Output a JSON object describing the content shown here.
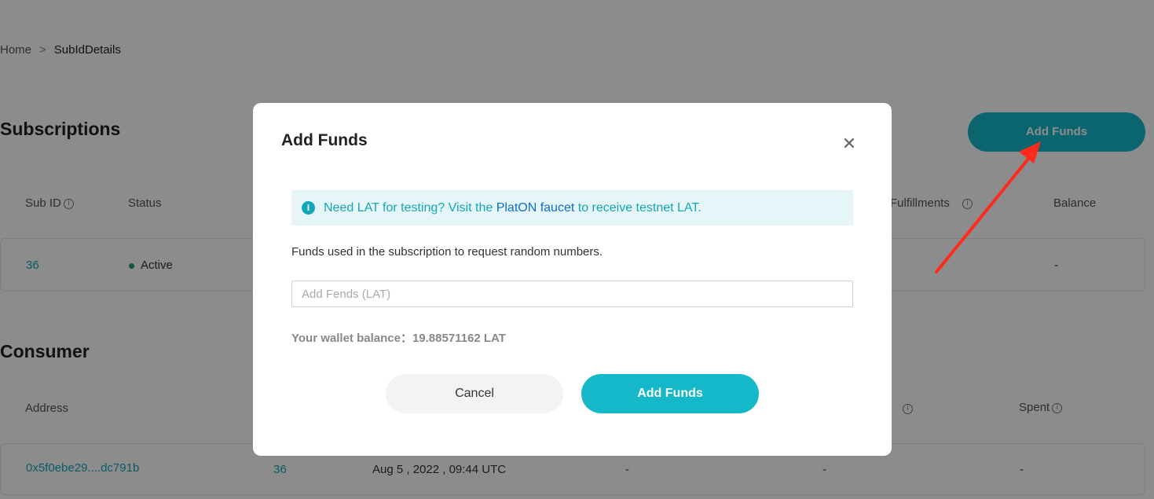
{
  "breadcrumb": {
    "home": "Home",
    "separator": ">",
    "current": "SubIdDetails"
  },
  "subscriptions": {
    "title": "Subscriptions",
    "add_funds_button": "Add Funds",
    "columns": {
      "sub_id": "Sub ID",
      "status": "Status",
      "fulfillments": "Fulfillments",
      "balance": "Balance"
    },
    "row": {
      "sub_id": "36",
      "status": "Active",
      "balance": "-"
    }
  },
  "consumer": {
    "title": "Consumer",
    "columns": {
      "address": "Address",
      "spent": "Spent"
    },
    "row": {
      "address": "0x5f0ebe29....dc791b",
      "sub_id": "36",
      "date": "Aug 5 , 2022 , 09:44 UTC",
      "col4": "-",
      "col5": "-",
      "spent": "-"
    }
  },
  "modal": {
    "title": "Add Funds",
    "close_icon": "close-icon",
    "alert": {
      "before": "Need LAT for testing? Visit the ",
      "link": "PlatON faucet",
      "after": " to receive testnet LAT."
    },
    "description": "Funds used in the subscription to request random numbers.",
    "input_placeholder": "Add Fends (LAT)",
    "balance_label": "Your wallet balance：",
    "balance_value": "19.88571162 LAT",
    "cancel_label": "Cancel",
    "submit_label": "Add Funds"
  },
  "colors": {
    "accent": "#14b8c9",
    "link": "#12a7b8",
    "faucet_link": "#0a6fd1",
    "status_active": "#1b9b6c",
    "arrow": "#ff2a1a"
  }
}
